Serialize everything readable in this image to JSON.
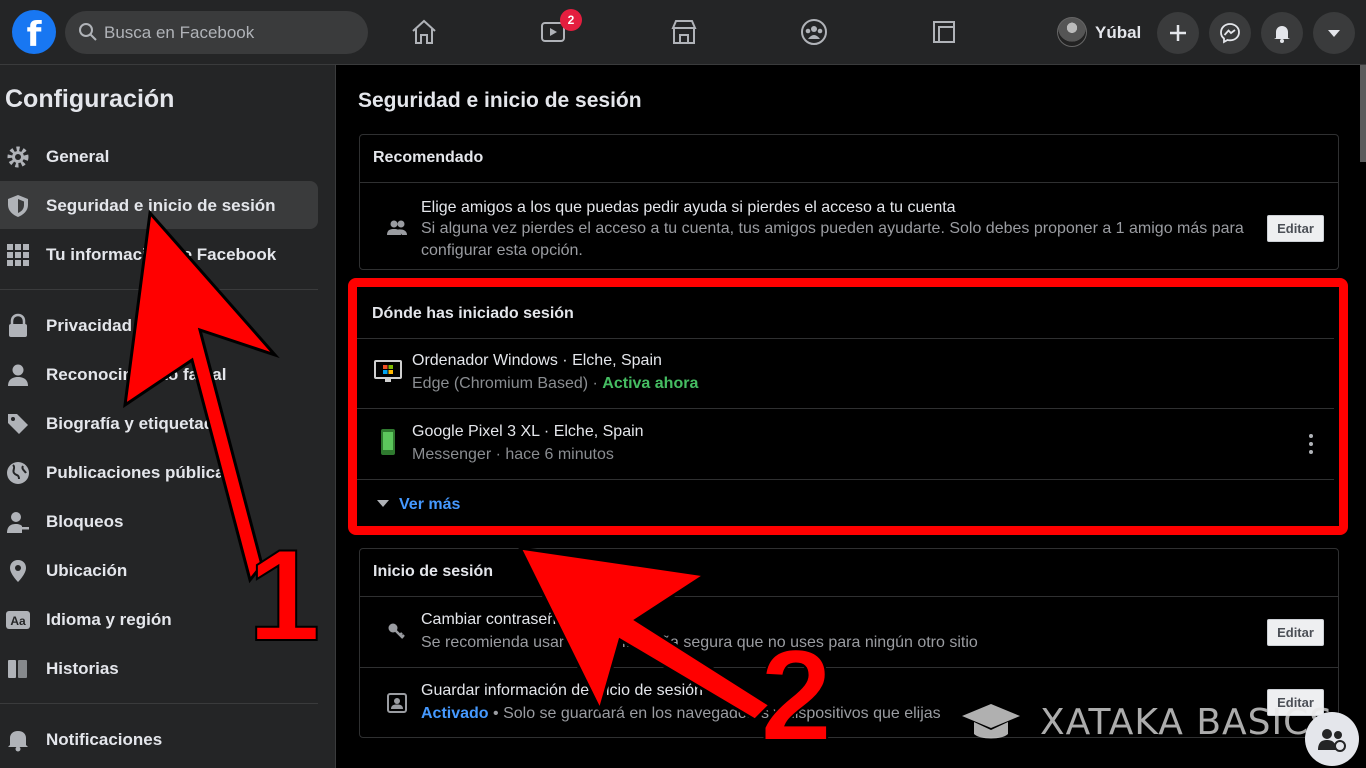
{
  "topbar": {
    "logo": "f",
    "search_placeholder": "Busca en Facebook",
    "watch_badge": "2",
    "profile_name": "Yúbal",
    "nav_icons": [
      "home-icon",
      "watch-icon",
      "marketplace-icon",
      "groups-icon",
      "gaming-icon"
    ],
    "action_icons": [
      "plus-icon",
      "messenger-icon",
      "bell-icon",
      "caret-down-icon"
    ]
  },
  "sidebar": {
    "title": "Configuración",
    "items": [
      {
        "label": "General",
        "icon": "gear-icon"
      },
      {
        "label": "Seguridad e inicio de sesión",
        "icon": "shield-icon",
        "active": true
      },
      {
        "label": "Tu información de Facebook",
        "icon": "grid-icon"
      },
      {
        "label": "Privacidad",
        "icon": "lock-icon"
      },
      {
        "label": "Reconocimiento facial",
        "icon": "person-icon"
      },
      {
        "label": "Biografía y etiquetado",
        "icon": "tag-icon"
      },
      {
        "label": "Publicaciones públicas",
        "icon": "globe-icon"
      },
      {
        "label": "Bloqueos",
        "icon": "person-block-icon"
      },
      {
        "label": "Ubicación",
        "icon": "pin-icon"
      },
      {
        "label": "Idioma y región",
        "icon": "aa-icon"
      },
      {
        "label": "Historias",
        "icon": "book-icon"
      },
      {
        "label": "Notificaciones",
        "icon": "bell-icon"
      }
    ]
  },
  "main": {
    "title": "Seguridad e inicio de sesión",
    "recommended": {
      "header": "Recomendado",
      "title": "Elige amigos a los que puedas pedir ayuda si pierdes el acceso a tu cuenta",
      "desc": "Si alguna vez pierdes el acceso a tu cuenta, tus amigos pueden ayudarte. Solo debes proponer a 1 amigo más para configurar esta opción.",
      "button": "Editar"
    },
    "sessions": {
      "header": "Dónde has iniciado sesión",
      "items": [
        {
          "device": "Ordenador Windows · Elche, Spain",
          "detail": "Edge (Chromium Based) · ",
          "status": "Activa ahora"
        },
        {
          "device": "Google Pixel 3 XL · Elche, Spain",
          "detail": "Messenger · hace 6 minutos"
        }
      ],
      "more": "Ver más"
    },
    "login": {
      "header": "Inicio de sesión",
      "rows": [
        {
          "title": "Cambiar contraseña",
          "desc": "Se recomienda usar una contraseña segura que no uses para ningún otro sitio",
          "button": "Editar"
        },
        {
          "title": "Guardar información de inicio de sesión",
          "status": "Activado",
          "desc": " • Solo se guardará en los navegadores y dispositivos que elijas",
          "button": "Editar"
        }
      ]
    }
  },
  "annotations": {
    "arrow1_label": "1",
    "arrow2_label": "2",
    "accent": "#ff0000"
  },
  "watermark": "XATAKA BASICS"
}
